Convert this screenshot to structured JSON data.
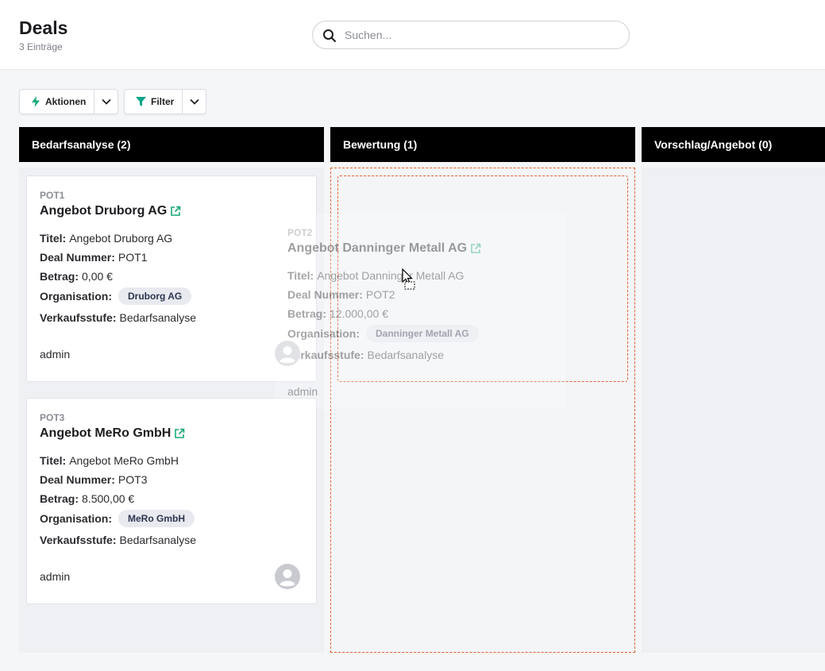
{
  "header": {
    "title": "Deals",
    "count": "3 Einträge",
    "search_placeholder": "Suchen..."
  },
  "toolbar": {
    "actions_label": "Aktionen",
    "filter_label": "Filter"
  },
  "colors": {
    "accent_green": "#18a97a",
    "filter_teal": "#0aa58a",
    "drop_border": "#e0622f",
    "column_header": "#000000"
  },
  "columns": [
    {
      "label": "Bedarfsanalyse (2)"
    },
    {
      "label": "Bewertung (1)"
    },
    {
      "label": "Vorschlag/Angebot (0)"
    }
  ],
  "field_labels": {
    "title": "Titel:",
    "deal_number": "Deal Nummer:",
    "amount": "Betrag:",
    "organization": "Organisation:",
    "stage": "Verkaufsstufe:"
  },
  "cards": [
    {
      "code": "POT1",
      "name": "Angebot Druborg AG",
      "title": "Angebot Druborg AG",
      "deal_number": "POT1",
      "amount": "0,00 €",
      "organization": "Druborg AG",
      "stage": "Bedarfsanalyse",
      "owner": "admin"
    },
    {
      "code": "POT3",
      "name": "Angebot MeRo GmbH",
      "title": "Angebot MeRo GmbH",
      "deal_number": "POT3",
      "amount": "8.500,00 €",
      "organization": "MeRo GmbH",
      "stage": "Bedarfsanalyse",
      "owner": "admin"
    },
    {
      "code": "POT2",
      "name": "Angebot Danninger Metall AG",
      "title": "Angebot Danninger Metall AG",
      "deal_number": "POT2",
      "amount": "12.000,00 €",
      "organization": "Danninger Metall AG",
      "stage": "Bedarfsanalyse",
      "owner": "admin"
    }
  ]
}
